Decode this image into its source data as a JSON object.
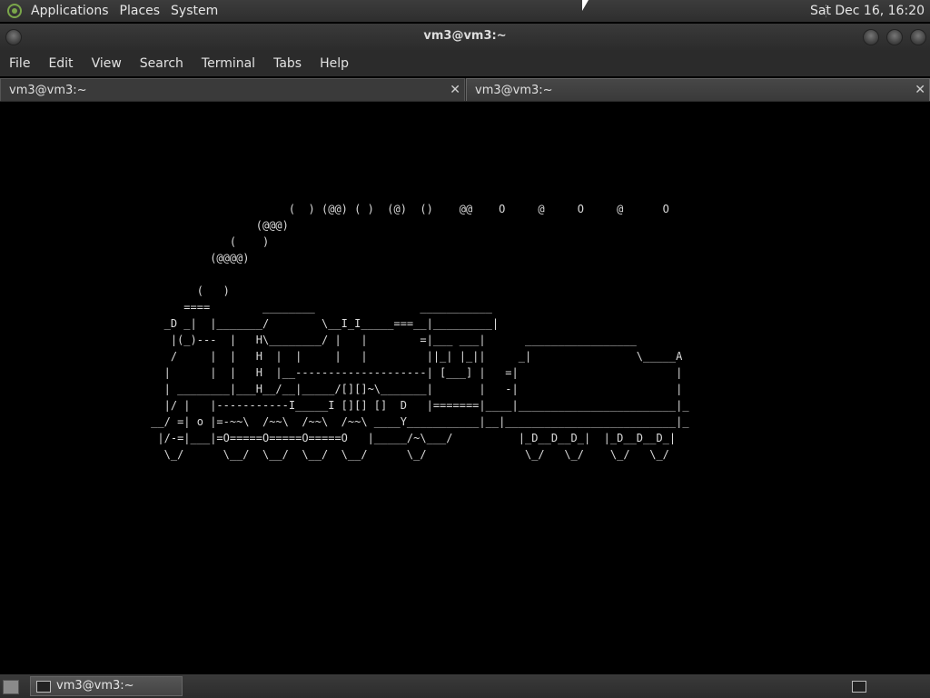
{
  "top_panel": {
    "menus": [
      "Applications",
      "Places",
      "System"
    ],
    "clock": "Sat Dec 16, 16:20"
  },
  "window": {
    "title": "vm3@vm3:~",
    "menubar": [
      "File",
      "Edit",
      "View",
      "Search",
      "Terminal",
      "Tabs",
      "Help"
    ],
    "tabs": [
      {
        "label": "vm3@vm3:~"
      },
      {
        "label": "vm3@vm3:~"
      }
    ],
    "terminal_lines": [
      "                                            (  ) (@@) ( )  (@)  ()    @@    O     @     O     @      O",
      "                                       (@@@)",
      "                                   (    )",
      "                                (@@@@)",
      "",
      "                              (   )",
      "                            ====        ________                ___________",
      "                         _D _|  |_______/        \\__I_I_____===__|_________|",
      "                          |(_)---  |   H\\________/ |   |        =|___ ___|      _________________",
      "                          /     |  |   H  |  |     |   |         ||_| |_||     _|                \\_____A",
      "                         |      |  |   H  |__--------------------| [___] |   =|                        |",
      "                         | ________|___H__/__|_____/[][]~\\_______|       |   -|                        |",
      "                         |/ |   |-----------I_____I [][] []  D   |=======|____|________________________|_",
      "                       __/ =| o |=-~~\\  /~~\\  /~~\\  /~~\\ ____Y___________|__|__________________________|_",
      "                        |/-=|___|=O=====O=====O=====O   |_____/~\\___/          |_D__D__D_|  |_D__D__D_|",
      "                         \\_/      \\__/  \\__/  \\__/  \\__/      \\_/               \\_/   \\_/    \\_/   \\_/"
    ]
  },
  "taskbar": {
    "task_label": "vm3@vm3:~"
  }
}
